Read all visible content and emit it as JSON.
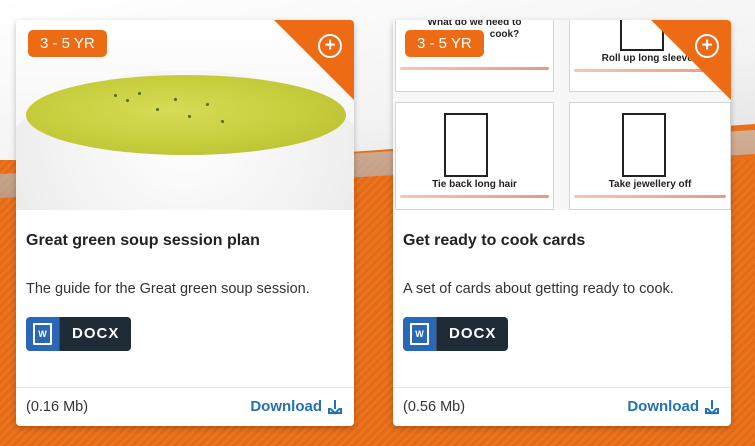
{
  "cards": [
    {
      "age": "3 - 5 YR",
      "title": "Great green soup session plan",
      "description": "The guide for the Great green soup session.",
      "file_type": "DOCX",
      "size": "(0.16 Mb)",
      "download_label": "Download",
      "image": "soup-bowl-photo"
    },
    {
      "age": "3 - 5 YR",
      "title": "Get ready to cook cards",
      "description": "A set of cards about getting ready to cook.",
      "file_type": "DOCX",
      "size": "(0.56 Mb)",
      "download_label": "Download",
      "image": "cooking-prep-cards",
      "image_captions": [
        "What do we need to",
        "cook?",
        "Roll up long sleeves",
        "Tie back long hair",
        "Take jewellery off"
      ]
    }
  ],
  "colors": {
    "accent": "#ee6b16",
    "link": "#2471b6",
    "docx_blue": "#2b67b7",
    "docx_dark": "#1f2b36"
  }
}
